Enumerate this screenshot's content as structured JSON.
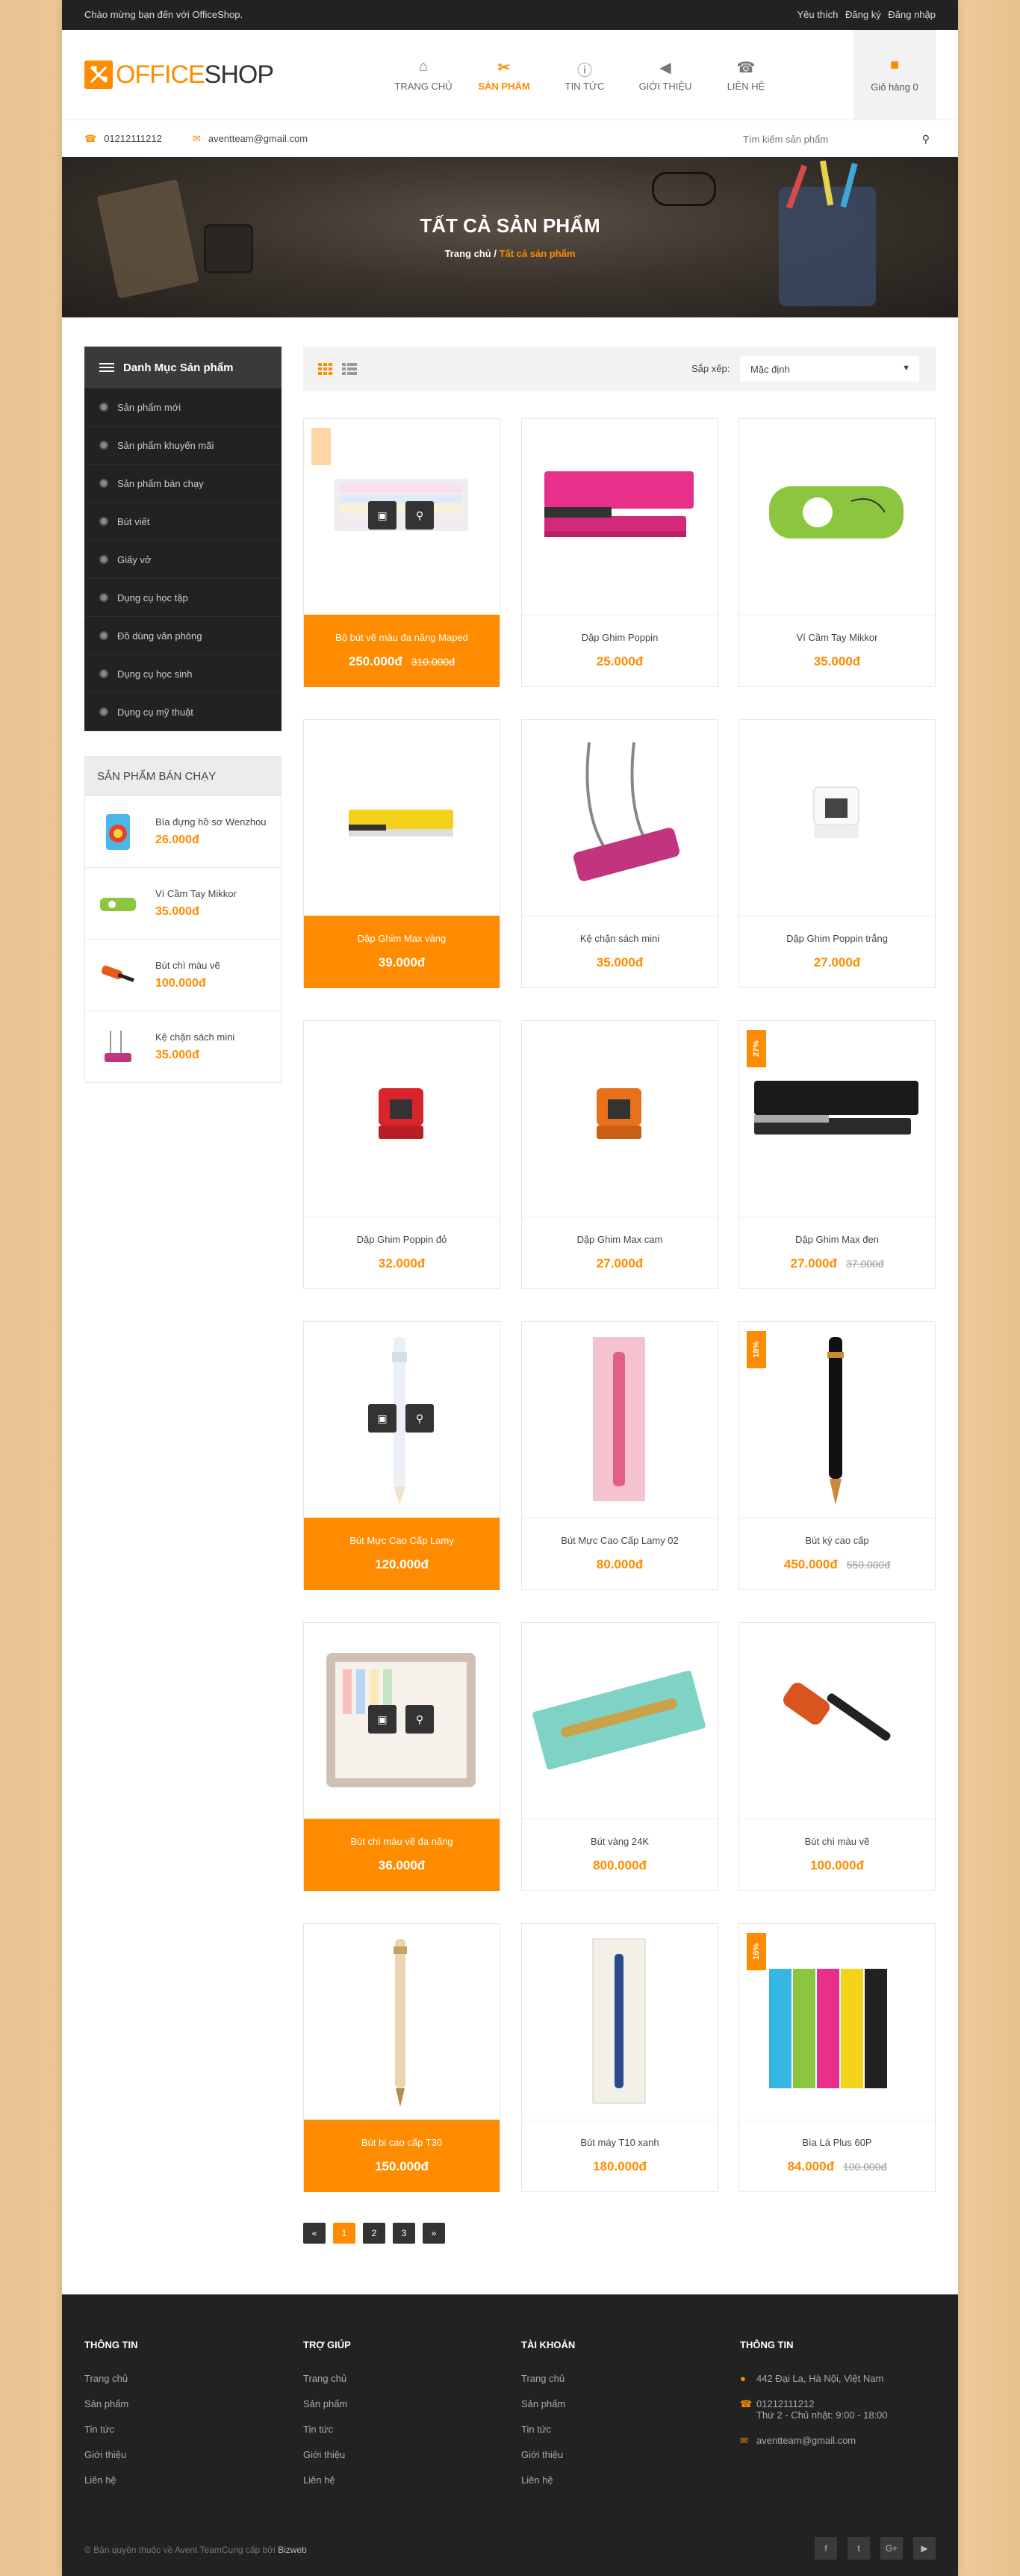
{
  "topbar": {
    "welcome": "Chào mừng bạn đến với OfficeShop.",
    "links": [
      "Yêu thích",
      "Đăng ký",
      "Đăng nhập"
    ]
  },
  "logo": {
    "part1": "OFFICE",
    "part2": "SHOP"
  },
  "nav": [
    {
      "label": "TRANG CHỦ",
      "icon": "home-icon"
    },
    {
      "label": "SẢN PHẨM",
      "icon": "tools-icon",
      "active": true
    },
    {
      "label": "TIN TỨC",
      "icon": "info-icon"
    },
    {
      "label": "GIỚI THIỆU",
      "icon": "megaphone-icon"
    },
    {
      "label": "LIÊN HỆ",
      "icon": "phone-icon"
    }
  ],
  "cart": {
    "label": "Giỏ hàng 0",
    "icon": "cart-icon"
  },
  "contact": {
    "phone": "01212111212",
    "email": "aventteam@gmail.com",
    "search_placeholder": "Tìm kiếm sản phẩm"
  },
  "banner": {
    "title": "TẤT CẢ SẢN PHẨM",
    "crumb_home": "Trang chủ",
    "crumb_sep": "/",
    "crumb_current": "Tất cả sản phẩm"
  },
  "sidebar": {
    "category_title": "Danh Mục Sản phẩm",
    "categories": [
      "Sản phẩm mới",
      "Sản phẩm khuyến mãi",
      "Sản phẩm bán chạy",
      "Bút viết",
      "Giấy vở",
      "Dụng cụ học tập",
      "Đồ dùng văn phòng",
      "Dụng cụ học sinh",
      "Dụng cụ mỹ thuật"
    ],
    "best_title": "SẢN PHẨM BÁN CHẠY",
    "best": [
      {
        "name": "Bìa đựng hồ sơ Wenzhou",
        "price": "26.000đ"
      },
      {
        "name": "Ví Cầm Tay Mikkor",
        "price": "35.000đ"
      },
      {
        "name": "Bút chì màu vẽ",
        "price": "100.000đ"
      },
      {
        "name": "Kệ chặn sách mini",
        "price": "35.000đ"
      }
    ]
  },
  "toolbar": {
    "sort_label": "Sắp xếp:",
    "sort_value": "Mặc định"
  },
  "products": [
    {
      "name": "Bộ bút vẽ màu đa năng Maped",
      "price": "250.000đ",
      "old": "310.000đ",
      "badge": "",
      "highlight": true,
      "hover": true
    },
    {
      "name": "Dập Ghim Poppin",
      "price": "25.000đ",
      "old": ""
    },
    {
      "name": "Ví Cầm Tay Mikkor",
      "price": "35.000đ",
      "old": ""
    },
    {
      "name": "Dập Ghim Max vàng",
      "price": "39.000đ",
      "old": "",
      "highlight": true
    },
    {
      "name": "Kệ chặn sách mini",
      "price": "35.000đ",
      "old": ""
    },
    {
      "name": "Dập Ghim Poppin trắng",
      "price": "27.000đ",
      "old": ""
    },
    {
      "name": "Dập Ghim Poppin đỏ",
      "price": "32.000đ",
      "old": ""
    },
    {
      "name": "Dập Ghim Max cam",
      "price": "27.000đ",
      "old": ""
    },
    {
      "name": "Dập Ghim Max đen",
      "price": "27.000đ",
      "old": "37.000đ",
      "badge": "27%"
    },
    {
      "name": "Bút Mực Cao Cấp Lamy",
      "price": "120.000đ",
      "old": "",
      "highlight": true,
      "hover": true
    },
    {
      "name": "Bút Mực Cao Cấp Lamy 02",
      "price": "80.000đ",
      "old": ""
    },
    {
      "name": "Bút ký cao cấp",
      "price": "450.000đ",
      "old": "550.000đ",
      "badge": "18%"
    },
    {
      "name": "Bút chì màu vẽ đa năng",
      "price": "36.000đ",
      "old": "",
      "highlight": true,
      "hover": true
    },
    {
      "name": "Bút vàng 24K",
      "price": "800.000đ",
      "old": ""
    },
    {
      "name": "Bút chì màu vẽ",
      "price": "100.000đ",
      "old": ""
    },
    {
      "name": "Bút bi cao cấp T30",
      "price": "150.000đ",
      "old": "",
      "highlight": true
    },
    {
      "name": "Bút máy T10 xanh",
      "price": "180.000đ",
      "old": ""
    },
    {
      "name": "Bìa Lá Plus 60P",
      "price": "84.000đ",
      "old": "100.000đ",
      "badge": "16%"
    }
  ],
  "pager": [
    "«",
    "1",
    "2",
    "3",
    "»"
  ],
  "footer": {
    "col1_title": "THÔNG TIN",
    "col1": [
      "Trang chủ",
      "Sản phẩm",
      "Tin tức",
      "Giới thiệu",
      "Liên hệ"
    ],
    "col2_title": "TRỢ GIÚP",
    "col2": [
      "Trang chủ",
      "Sản phẩm",
      "Tin tức",
      "Giới thiệu",
      "Liên hệ"
    ],
    "col3_title": "TÀI KHOẢN",
    "col3": [
      "Trang chủ",
      "Sản phẩm",
      "Tin tức",
      "Giới thiệu",
      "Liên hệ"
    ],
    "col4_title": "THÔNG TIN",
    "address": "442 Đại La, Hà Nội, Việt Nam",
    "phone": "01212111212",
    "hours": "Thứ 2 - Chủ nhật: 9:00 - 18:00",
    "email": "aventteam@gmail.com",
    "copyright": "© Bản quyền thuộc về Avent Team",
    "provided_by": "Cung cấp bởi",
    "provider": "Bizweb",
    "social": [
      "f",
      "t",
      "G+",
      "▶"
    ]
  },
  "colors": {
    "accent": "#ff8c00",
    "dark": "#222222"
  }
}
